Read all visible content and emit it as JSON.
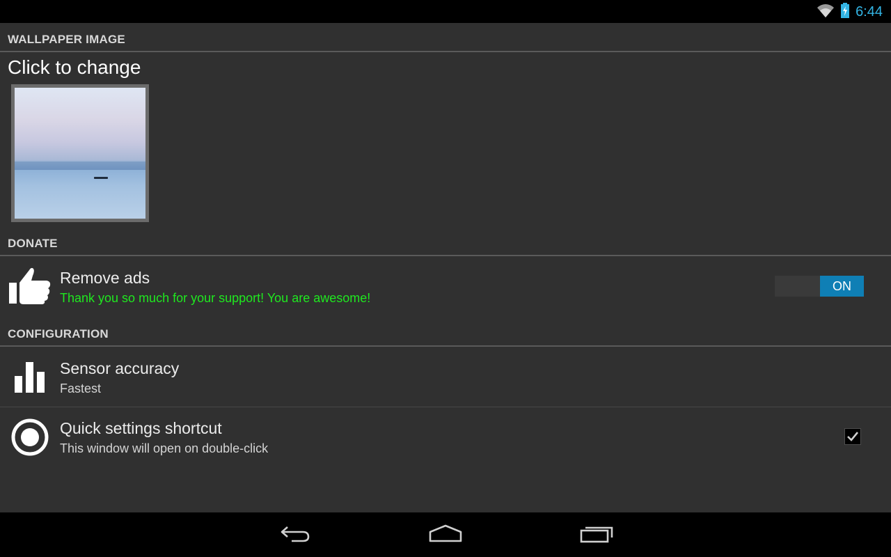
{
  "status_bar": {
    "time": "6:44",
    "icons": [
      "wifi-icon",
      "battery-charging-icon"
    ],
    "accent": "#33b5e5"
  },
  "sections": {
    "wallpaper": {
      "header": "WALLPAPER IMAGE",
      "hint": "Click to change"
    },
    "donate": {
      "header": "DONATE",
      "remove_ads": {
        "title": "Remove ads",
        "summary": "Thank you so much for your support! You are awesome!",
        "summary_color": "#1fe81f",
        "toggle_label": "ON",
        "toggle_state": true,
        "icon": "thumbs-up-icon"
      }
    },
    "configuration": {
      "header": "CONFIGURATION",
      "sensor_accuracy": {
        "title": "Sensor accuracy",
        "summary": "Fastest",
        "icon": "bar-chart-icon"
      },
      "quick_settings": {
        "title": "Quick settings shortcut",
        "summary": "This window will open on double-click",
        "checked": true,
        "icon": "radio-target-icon"
      }
    }
  },
  "nav_bar": {
    "buttons": [
      "back-icon",
      "home-icon",
      "recent-apps-icon"
    ]
  }
}
